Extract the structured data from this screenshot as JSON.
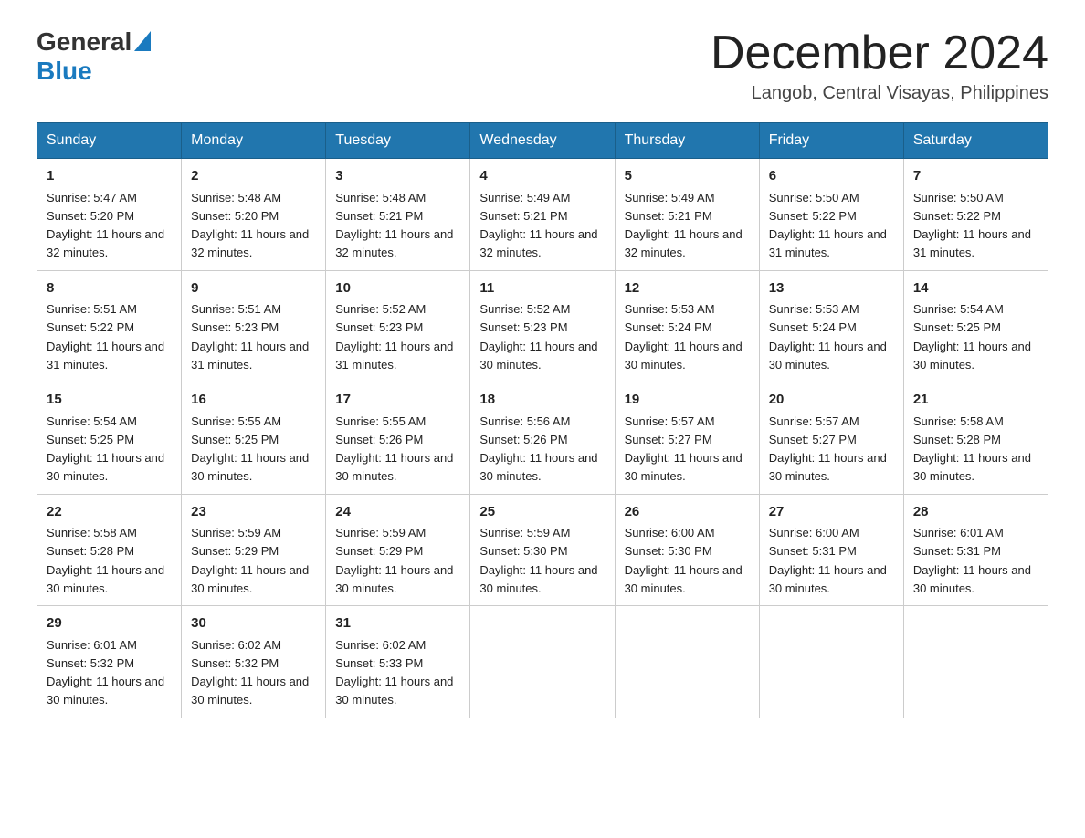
{
  "header": {
    "logo_general": "General",
    "logo_blue": "Blue",
    "month_title": "December 2024",
    "location": "Langob, Central Visayas, Philippines"
  },
  "days_of_week": [
    "Sunday",
    "Monday",
    "Tuesday",
    "Wednesday",
    "Thursday",
    "Friday",
    "Saturday"
  ],
  "weeks": [
    [
      {
        "day": "1",
        "sunrise": "5:47 AM",
        "sunset": "5:20 PM",
        "daylight": "11 hours and 32 minutes."
      },
      {
        "day": "2",
        "sunrise": "5:48 AM",
        "sunset": "5:20 PM",
        "daylight": "11 hours and 32 minutes."
      },
      {
        "day": "3",
        "sunrise": "5:48 AM",
        "sunset": "5:21 PM",
        "daylight": "11 hours and 32 minutes."
      },
      {
        "day": "4",
        "sunrise": "5:49 AM",
        "sunset": "5:21 PM",
        "daylight": "11 hours and 32 minutes."
      },
      {
        "day": "5",
        "sunrise": "5:49 AM",
        "sunset": "5:21 PM",
        "daylight": "11 hours and 32 minutes."
      },
      {
        "day": "6",
        "sunrise": "5:50 AM",
        "sunset": "5:22 PM",
        "daylight": "11 hours and 31 minutes."
      },
      {
        "day": "7",
        "sunrise": "5:50 AM",
        "sunset": "5:22 PM",
        "daylight": "11 hours and 31 minutes."
      }
    ],
    [
      {
        "day": "8",
        "sunrise": "5:51 AM",
        "sunset": "5:22 PM",
        "daylight": "11 hours and 31 minutes."
      },
      {
        "day": "9",
        "sunrise": "5:51 AM",
        "sunset": "5:23 PM",
        "daylight": "11 hours and 31 minutes."
      },
      {
        "day": "10",
        "sunrise": "5:52 AM",
        "sunset": "5:23 PM",
        "daylight": "11 hours and 31 minutes."
      },
      {
        "day": "11",
        "sunrise": "5:52 AM",
        "sunset": "5:23 PM",
        "daylight": "11 hours and 30 minutes."
      },
      {
        "day": "12",
        "sunrise": "5:53 AM",
        "sunset": "5:24 PM",
        "daylight": "11 hours and 30 minutes."
      },
      {
        "day": "13",
        "sunrise": "5:53 AM",
        "sunset": "5:24 PM",
        "daylight": "11 hours and 30 minutes."
      },
      {
        "day": "14",
        "sunrise": "5:54 AM",
        "sunset": "5:25 PM",
        "daylight": "11 hours and 30 minutes."
      }
    ],
    [
      {
        "day": "15",
        "sunrise": "5:54 AM",
        "sunset": "5:25 PM",
        "daylight": "11 hours and 30 minutes."
      },
      {
        "day": "16",
        "sunrise": "5:55 AM",
        "sunset": "5:25 PM",
        "daylight": "11 hours and 30 minutes."
      },
      {
        "day": "17",
        "sunrise": "5:55 AM",
        "sunset": "5:26 PM",
        "daylight": "11 hours and 30 minutes."
      },
      {
        "day": "18",
        "sunrise": "5:56 AM",
        "sunset": "5:26 PM",
        "daylight": "11 hours and 30 minutes."
      },
      {
        "day": "19",
        "sunrise": "5:57 AM",
        "sunset": "5:27 PM",
        "daylight": "11 hours and 30 minutes."
      },
      {
        "day": "20",
        "sunrise": "5:57 AM",
        "sunset": "5:27 PM",
        "daylight": "11 hours and 30 minutes."
      },
      {
        "day": "21",
        "sunrise": "5:58 AM",
        "sunset": "5:28 PM",
        "daylight": "11 hours and 30 minutes."
      }
    ],
    [
      {
        "day": "22",
        "sunrise": "5:58 AM",
        "sunset": "5:28 PM",
        "daylight": "11 hours and 30 minutes."
      },
      {
        "day": "23",
        "sunrise": "5:59 AM",
        "sunset": "5:29 PM",
        "daylight": "11 hours and 30 minutes."
      },
      {
        "day": "24",
        "sunrise": "5:59 AM",
        "sunset": "5:29 PM",
        "daylight": "11 hours and 30 minutes."
      },
      {
        "day": "25",
        "sunrise": "5:59 AM",
        "sunset": "5:30 PM",
        "daylight": "11 hours and 30 minutes."
      },
      {
        "day": "26",
        "sunrise": "6:00 AM",
        "sunset": "5:30 PM",
        "daylight": "11 hours and 30 minutes."
      },
      {
        "day": "27",
        "sunrise": "6:00 AM",
        "sunset": "5:31 PM",
        "daylight": "11 hours and 30 minutes."
      },
      {
        "day": "28",
        "sunrise": "6:01 AM",
        "sunset": "5:31 PM",
        "daylight": "11 hours and 30 minutes."
      }
    ],
    [
      {
        "day": "29",
        "sunrise": "6:01 AM",
        "sunset": "5:32 PM",
        "daylight": "11 hours and 30 minutes."
      },
      {
        "day": "30",
        "sunrise": "6:02 AM",
        "sunset": "5:32 PM",
        "daylight": "11 hours and 30 minutes."
      },
      {
        "day": "31",
        "sunrise": "6:02 AM",
        "sunset": "5:33 PM",
        "daylight": "11 hours and 30 minutes."
      },
      null,
      null,
      null,
      null
    ]
  ]
}
